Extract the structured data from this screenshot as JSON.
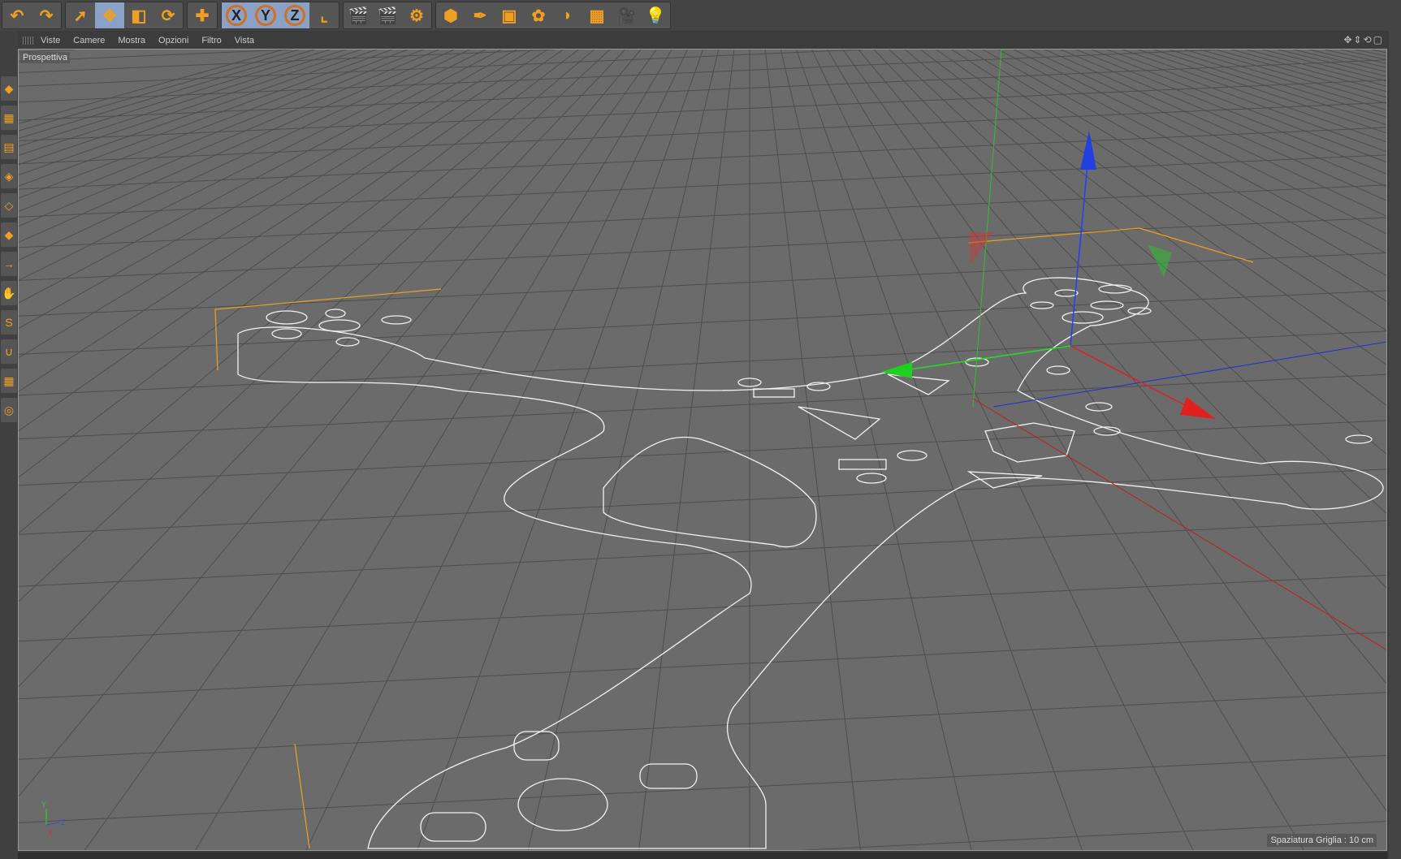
{
  "toolbar": {
    "groups": [
      [
        {
          "icon": "undo-icon"
        },
        {
          "icon": "redo-icon"
        }
      ],
      [
        {
          "icon": "select-arrow-icon"
        },
        {
          "icon": "move-icon",
          "active": true
        },
        {
          "icon": "scale-icon"
        },
        {
          "icon": "rotate-icon"
        }
      ],
      [
        {
          "icon": "add-icon"
        }
      ],
      [
        {
          "icon": "x-axis-icon",
          "label": "X",
          "active": true
        },
        {
          "icon": "y-axis-icon",
          "label": "Y",
          "active": true
        },
        {
          "icon": "z-axis-icon",
          "label": "Z",
          "active": true
        },
        {
          "icon": "coordinate-system-icon"
        }
      ],
      [
        {
          "icon": "render-view-icon"
        },
        {
          "icon": "render-picture-viewer-icon"
        },
        {
          "icon": "render-settings-icon"
        }
      ],
      [
        {
          "icon": "cube-icon"
        },
        {
          "icon": "pen-icon"
        },
        {
          "icon": "subdivision-icon"
        },
        {
          "icon": "array-icon"
        },
        {
          "icon": "deformer-icon"
        },
        {
          "icon": "floor-icon"
        },
        {
          "icon": "camera-icon"
        },
        {
          "icon": "light-icon"
        }
      ]
    ]
  },
  "menu": {
    "items": [
      "Viste",
      "Camere",
      "Mostra",
      "Opzioni",
      "Filtro",
      "Vista"
    ]
  },
  "viewport": {
    "label": "Prospettiva",
    "grid_spacing": "Spaziatura Griglia : 10 cm",
    "axis_labels": [
      "Y",
      "Z",
      "X"
    ]
  },
  "colors": {
    "x_axis": "#e02020",
    "y_axis": "#20d020",
    "z_axis": "#2040e0",
    "selection": "#f0a020",
    "background": "#6b6b6b"
  }
}
